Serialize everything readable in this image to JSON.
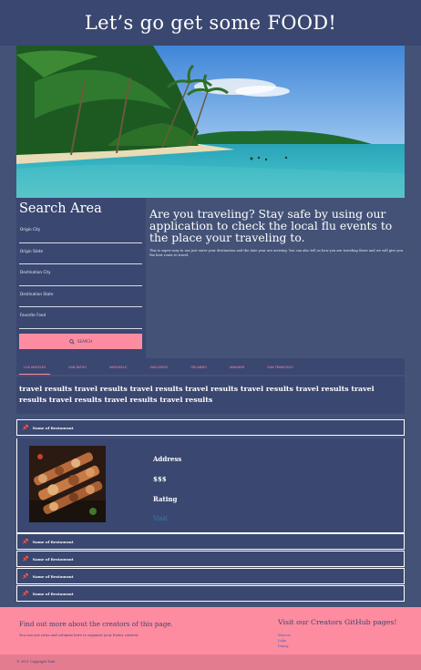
{
  "header": {
    "title": "Let’s go get some FOOD!"
  },
  "search": {
    "title": "Search Area",
    "fields": [
      "Origin City",
      "Origin State",
      "Destination City",
      "Destination State",
      "Favorite Food"
    ],
    "button_label": "SEARCH"
  },
  "intro": {
    "heading": "Are you traveling? Stay safe by using our application to check the local flu events to the place your traveling to.",
    "body": "This is super easy to use just enter your destination and the date your are arriving. You can also tell us how you are traveling there and we will give you the best route to travel."
  },
  "tabs": [
    "LOS ANGELES",
    "SAN DIEGO",
    "NASHVILLE",
    "SAN DIEGO",
    "ORLANDO",
    "ANAHEIM",
    "SAN FRANCISCO"
  ],
  "results_text": "travel results travel results travel results travel results travel results travel results travel results travel results travel results travel results",
  "restaurants": {
    "label": "Name of Restaurant",
    "details": {
      "address": "Address",
      "price": "$$$",
      "rating": "Rating",
      "link": "Visit"
    }
  },
  "footer": {
    "left_heading": "Find out more about the creators of this page.",
    "left_text": "You can use rows and columns here to organize your footer content.",
    "right_heading": "Visit our Creators GitHub pages!",
    "links": [
      "Marcus",
      "Luke",
      "Danny"
    ]
  },
  "copyright": "© 2021 Copyright Text",
  "colors": {
    "navy": "#3a4770",
    "background": "#445277",
    "pink": "#fd8ca0",
    "link": "#2f83b8"
  }
}
